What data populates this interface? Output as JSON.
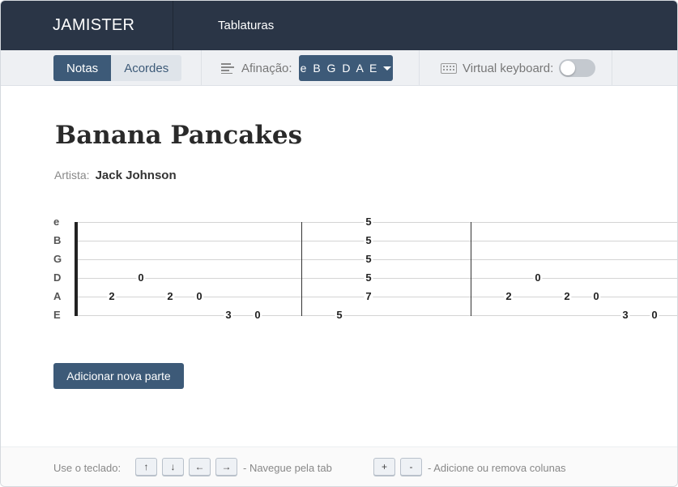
{
  "nav": {
    "brand": "JAMISTER",
    "link": "Tablaturas"
  },
  "toolbar": {
    "mode_notes": "Notas",
    "mode_chords": "Acordes",
    "tuning_label": "Afinação:",
    "tuning_value": "e B G D A E",
    "vk_label": "Virtual keyboard:",
    "vk_enabled": false
  },
  "song": {
    "title": "Banana Pancakes",
    "artist_label": "Artista:",
    "artist": "Jack Johnson"
  },
  "tab": {
    "strings": [
      "e",
      "B",
      "G",
      "D",
      "A",
      "E"
    ],
    "notes": [
      {
        "s": 4,
        "col": 0,
        "v": "2"
      },
      {
        "s": 3,
        "col": 1,
        "v": "0"
      },
      {
        "s": 4,
        "col": 2,
        "v": "2"
      },
      {
        "s": 4,
        "col": 3,
        "v": "0"
      },
      {
        "s": 5,
        "col": 4,
        "v": "3"
      },
      {
        "s": 5,
        "col": 5,
        "v": "0"
      },
      {
        "s": 5,
        "col": 6,
        "v": "5"
      },
      {
        "s": 0,
        "col": 7,
        "v": "5"
      },
      {
        "s": 1,
        "col": 7,
        "v": "5"
      },
      {
        "s": 2,
        "col": 7,
        "v": "5"
      },
      {
        "s": 3,
        "col": 7,
        "v": "5"
      },
      {
        "s": 4,
        "col": 7,
        "v": "7"
      },
      {
        "s": 4,
        "col": 8,
        "v": "2"
      },
      {
        "s": 3,
        "col": 9,
        "v": "0"
      },
      {
        "s": 4,
        "col": 10,
        "v": "2"
      },
      {
        "s": 4,
        "col": 11,
        "v": "0"
      },
      {
        "s": 5,
        "col": 12,
        "v": "3"
      },
      {
        "s": 5,
        "col": 13,
        "v": "0"
      }
    ]
  },
  "add_part_label": "Adicionar nova parte",
  "footer": {
    "use_keys": "Use o teclado:",
    "arrows": [
      "↑",
      "↓",
      "←",
      "→"
    ],
    "nav_hint": "- Navegue pela tab",
    "plusminus": [
      "+",
      "-"
    ],
    "col_hint": "- Adicione ou remova colunas"
  }
}
